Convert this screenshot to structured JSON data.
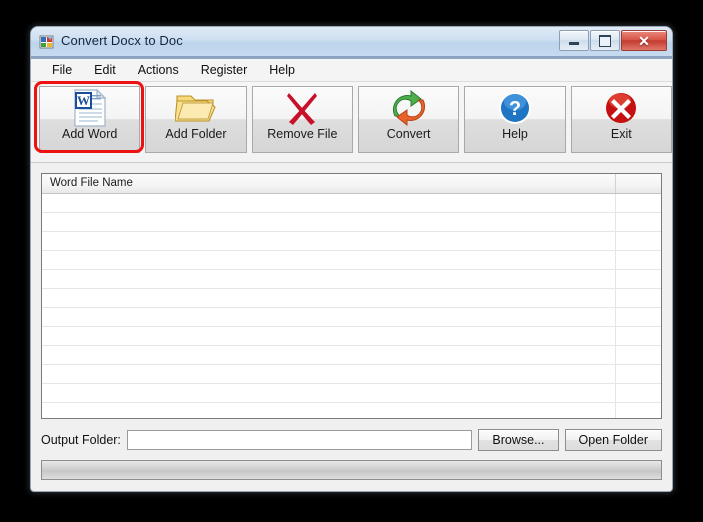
{
  "window": {
    "title": "Convert Docx to Doc",
    "title_icon": "app-icon",
    "caption": {
      "minimize": "minimize-icon",
      "maximize": "maximize-icon",
      "close": "✕"
    }
  },
  "menu": {
    "items": [
      {
        "label": "File"
      },
      {
        "label": "Edit"
      },
      {
        "label": "Actions"
      },
      {
        "label": "Register"
      },
      {
        "label": "Help"
      }
    ]
  },
  "toolbar": {
    "buttons": [
      {
        "label": "Add Word",
        "icon": "word-document-icon",
        "highlighted": true
      },
      {
        "label": "Add Folder",
        "icon": "open-folder-icon",
        "highlighted": false
      },
      {
        "label": "Remove File",
        "icon": "red-x-icon",
        "highlighted": false
      },
      {
        "label": "Convert",
        "icon": "convert-arrows-icon",
        "highlighted": false
      },
      {
        "label": "Help",
        "icon": "blue-question-icon",
        "highlighted": false
      },
      {
        "label": "Exit",
        "icon": "red-circle-x-icon",
        "highlighted": false
      }
    ]
  },
  "file_list": {
    "columns": [
      "Word File Name",
      ""
    ],
    "rows": [],
    "empty_row_count": 13
  },
  "output": {
    "label": "Output Folder:",
    "value": "",
    "placeholder": "",
    "browse_label": "Browse...",
    "open_folder_label": "Open Folder"
  },
  "status": {
    "progress_percent": 0,
    "text": ""
  },
  "colors": {
    "highlight": "#ee1111",
    "title_bar": "#bcd4ec",
    "close_button": "#c33b2e",
    "window_face": "#f0f0f0"
  }
}
